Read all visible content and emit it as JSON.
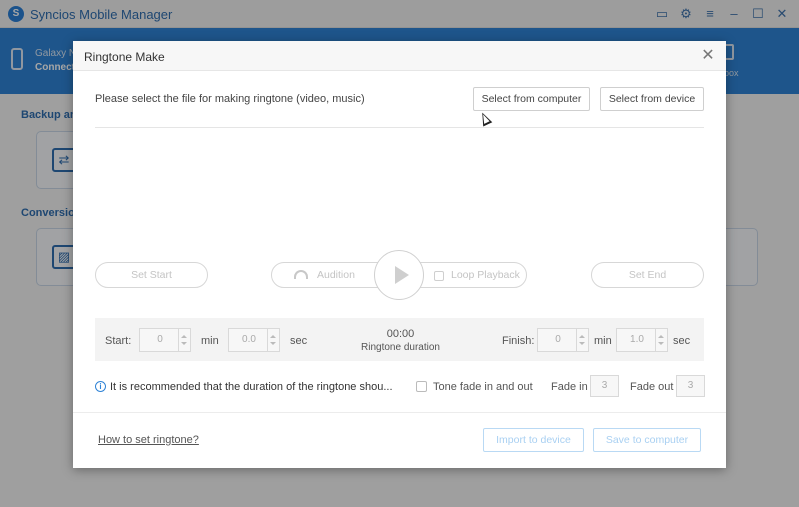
{
  "app": {
    "title": "Syncios Mobile Manager",
    "logo_letter": "S",
    "titlebar_icons": [
      "window-icon",
      "gear-icon",
      "menu-icon",
      "minimize-icon",
      "maximize-icon",
      "close-icon"
    ],
    "titlebar_glyphs": {
      "window": "▭",
      "gear": "⚙",
      "menu": "≡",
      "minimize": "–",
      "maximize": "☐",
      "close": "✕"
    }
  },
  "device": {
    "name": "Galaxy N",
    "status": "Connect",
    "toolbox_label": "box"
  },
  "background": {
    "sections": [
      {
        "title": "Backup an"
      },
      {
        "title": "Conversion"
      }
    ],
    "card_glyphs": [
      "⇄",
      "▨"
    ]
  },
  "dialog": {
    "title": "Ringtone Make",
    "close_glyph": "✕",
    "prompt": "Please select the file for making ringtone (video, music)",
    "select_computer_label": "Select from computer",
    "select_device_label": "Select from device",
    "set_start_label": "Set Start",
    "audition_label": "Audition",
    "loop_label": "Loop Playback",
    "set_end_label": "Set End",
    "start_label": "Start:",
    "start_min_value": "0",
    "start_sec_value": "0.0",
    "min_unit": "min",
    "sec_unit": "sec",
    "duration_time": "00:00",
    "duration_label": "Ringtone duration",
    "finish_label": "Finish:",
    "finish_min_value": "0",
    "finish_sec_value": "1.0",
    "info_glyph": "i",
    "info_text": "It is recommended that the duration of the ringtone shou...",
    "fade_toggle_label": "Tone fade in and out",
    "fade_in_label": "Fade in",
    "fade_in_value": "3",
    "fade_out_label": "Fade out",
    "fade_out_value": "3",
    "howto_link": "How to set ringtone?",
    "import_label": "Import to device",
    "save_label": "Save to computer"
  },
  "colors": {
    "accent": "#2f83d6",
    "title_text": "#2f6db0",
    "disabled_button_text": "#a9d0f2"
  }
}
